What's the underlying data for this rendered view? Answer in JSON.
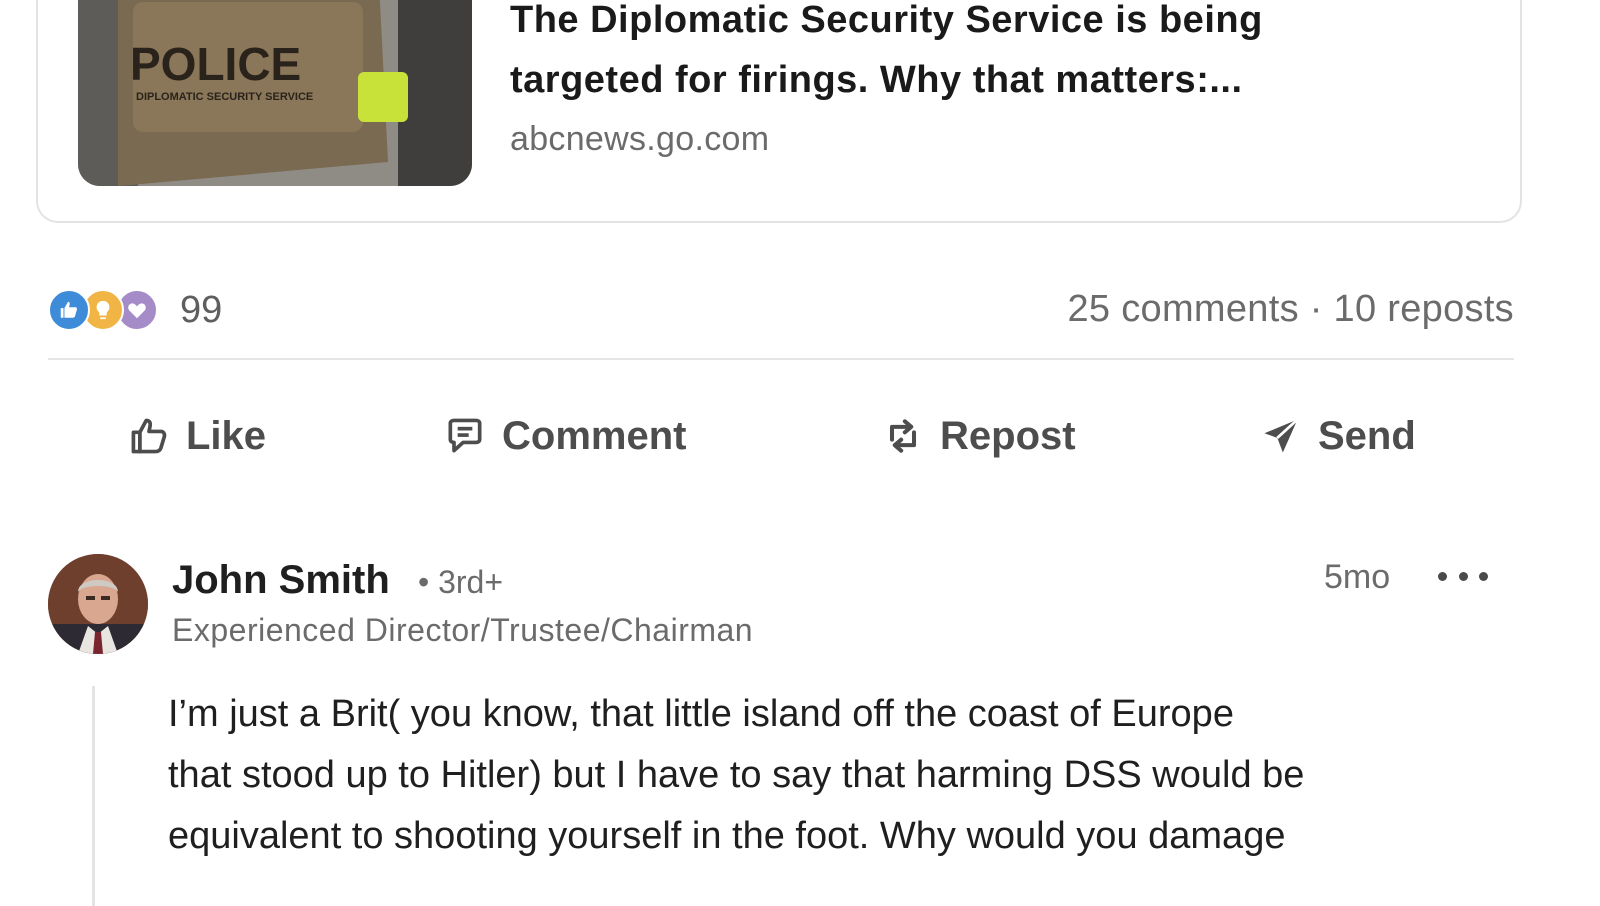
{
  "article": {
    "title_lines": [
      "The Diplomatic Security Service is being",
      "targeted for firings. Why that matters:..."
    ],
    "source": "abcnews.go.com",
    "thumbnail_vest_text": "POLICE",
    "thumbnail_vest_subtext": "DIPLOMATIC SECURITY SERVICE"
  },
  "social": {
    "reaction_icons": [
      "like-icon",
      "insightful-icon",
      "love-icon"
    ],
    "reaction_count": "99",
    "comments_reposts": "25 comments · 10 reposts"
  },
  "actions": {
    "like": "Like",
    "comment": "Comment",
    "repost": "Repost",
    "send": "Send"
  },
  "comment": {
    "author": "John Smith",
    "degree": "• 3rd+",
    "headline": "Experienced Director/Trustee/Chairman",
    "time": "5mo",
    "text_lines": [
      "I’m just a Brit( you know, that little island off the coast of Europe",
      "that stood up to Hitler) but I have to say that harming DSS would be",
      "equivalent to shooting yourself in the foot. Why would you damage"
    ]
  },
  "colors": {
    "text_primary": "#1f1f1f",
    "text_secondary": "#6b6b6b",
    "action_text": "#4d4d4d",
    "like_reaction": "#3d8bd9",
    "insight_reaction": "#f0b545",
    "love_reaction": "#a58bc7"
  }
}
